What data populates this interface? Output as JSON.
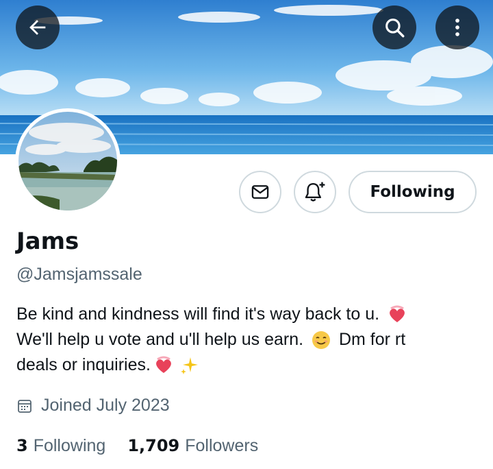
{
  "header": {
    "back_icon": "arrow-left-icon",
    "search_icon": "search-icon",
    "more_icon": "more-vertical-icon"
  },
  "banner": {
    "description_colors": {
      "sky": "#5aa9e6",
      "sea": "#1f6fbf"
    }
  },
  "actions": {
    "message_icon": "envelope-icon",
    "notify_icon": "bell-plus-icon",
    "follow_label": "Following"
  },
  "profile": {
    "name": "Jams",
    "handle": "@Jamsjamssale",
    "bio": {
      "line1": "Be kind and kindness will find it's way back to u.",
      "line2a": "We'll help u vote and u'll help us earn.",
      "line2b": "Dm for rt",
      "line3": "deals or inquiries."
    },
    "joined": "Joined July 2023",
    "joined_icon": "calendar-icon"
  },
  "stats": {
    "following_count": "3",
    "following_label": "Following",
    "followers_count": "1,709",
    "followers_label": "Followers"
  },
  "colors": {
    "text": "#0f1419",
    "muted": "#536471",
    "border": "#cfd9de"
  }
}
